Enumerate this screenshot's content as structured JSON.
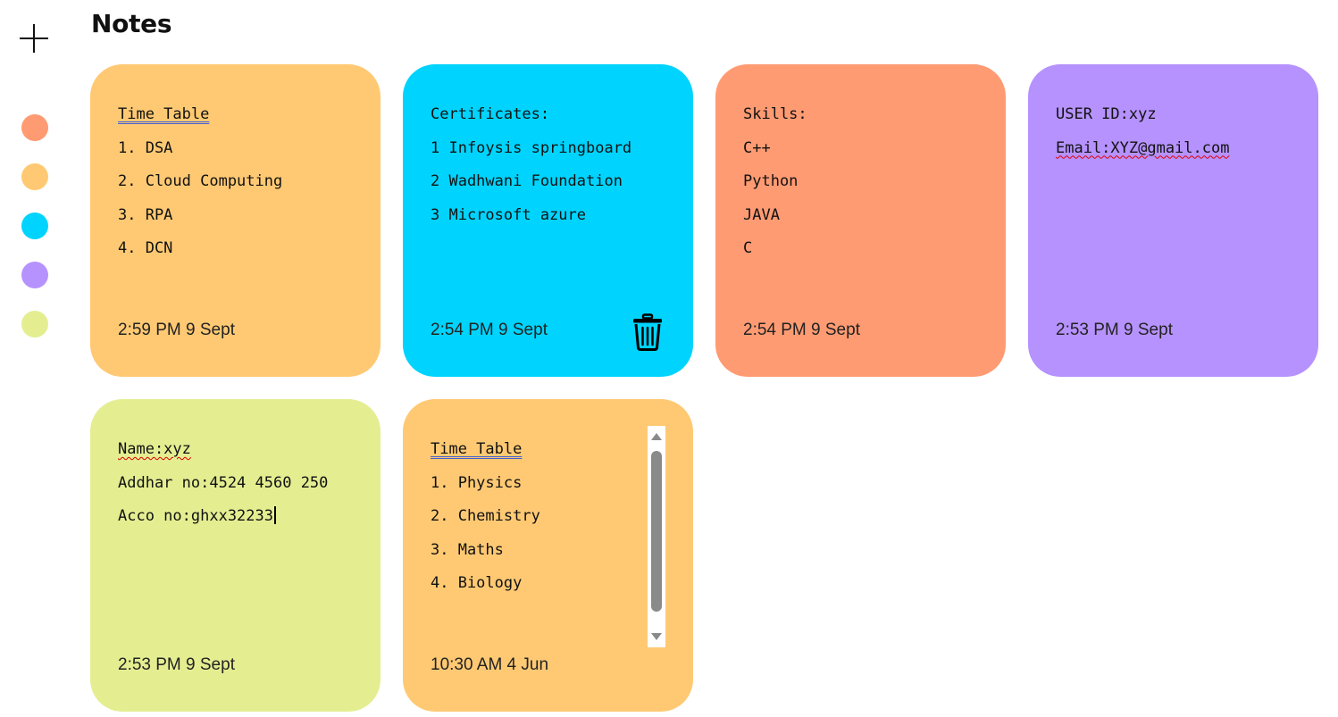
{
  "page": {
    "title": "Notes"
  },
  "sidebar": {
    "add_icon": "plus-icon",
    "swatches": [
      {
        "name": "orange",
        "color": "#ff9b73"
      },
      {
        "name": "yellow",
        "color": "#ffc973"
      },
      {
        "name": "cyan",
        "color": "#00d4fe"
      },
      {
        "name": "purple",
        "color": "#b692fe"
      },
      {
        "name": "lime",
        "color": "#e4ee91"
      }
    ]
  },
  "notes": [
    {
      "color": "#ffc973",
      "lines": [
        "Time Table",
        "1. DSA",
        "2. Cloud Computing",
        "3. RPA",
        "4. DCN"
      ],
      "date": "2:59 PM 9 Sept"
    },
    {
      "color": "#00d4fe",
      "lines": [
        "Certificates:",
        "1 Infoysis springboard",
        "2 Wadhwani Foundation",
        "3 Microsoft azure"
      ],
      "date": "2:54 PM 9 Sept",
      "delete_icon": "trash-icon"
    },
    {
      "color": "#ff9b73",
      "lines": [
        "Skills:",
        "C++",
        "Python",
        "JAVA",
        "C"
      ],
      "date": "2:54 PM 9 Sept"
    },
    {
      "color": "#b692fe",
      "lines": [
        "USER ID:xyz",
        "Email:XYZ@gmail.com"
      ],
      "date": "2:53 PM 9 Sept"
    },
    {
      "color": "#e4ee91",
      "lines": [
        "Name:xyz",
        "Addhar no:4524 4560 250",
        "Acco no:ghxx32233"
      ],
      "date": "2:53 PM 9 Sept"
    },
    {
      "color": "#ffc973",
      "lines": [
        "Time Table",
        "1. Physics",
        "2. Chemistry",
        "3. Maths",
        "4. Biology"
      ],
      "date": "10:30 AM 4 Jun"
    }
  ]
}
